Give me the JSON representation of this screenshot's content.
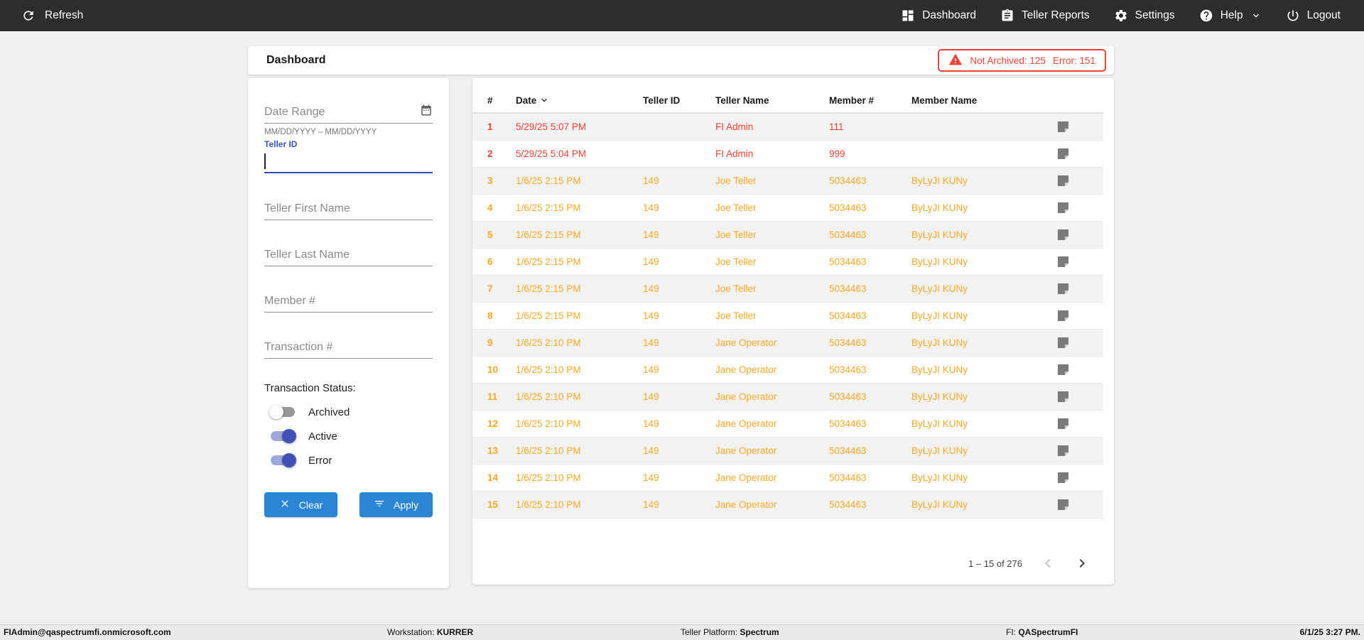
{
  "colors": {
    "error": "#f44336",
    "active_row": "#ffa726",
    "button_blue": "#2a86d5",
    "toggle_indigo": "#3f51b5",
    "topbar_bg": "#2d2d2d"
  },
  "topbar": {
    "refresh_label": "Refresh",
    "refresh_icon": "refresh-icon",
    "nav": [
      {
        "label": "Dashboard",
        "icon": "dashboard-icon",
        "has_dropdown": false
      },
      {
        "label": "Teller Reports",
        "icon": "reports-icon",
        "has_dropdown": false
      },
      {
        "label": "Settings",
        "icon": "settings-icon",
        "has_dropdown": false
      },
      {
        "label": "Help",
        "icon": "help-icon",
        "has_dropdown": true
      },
      {
        "label": "Logout",
        "icon": "logout-icon",
        "has_dropdown": false
      }
    ]
  },
  "header": {
    "title": "Dashboard",
    "alert": {
      "icon": "warning-icon",
      "not_archived": "Not Archived: 125",
      "error": "Error: 151"
    }
  },
  "filters": {
    "date_range": {
      "placeholder": "Date Range",
      "helper": "MM/DD/YYYY – MM/DD/YYYY",
      "icon": "calendar-icon",
      "value": ""
    },
    "teller_id": {
      "label": "Teller ID",
      "value": ""
    },
    "teller_first_name": {
      "placeholder": "Teller First Name",
      "value": ""
    },
    "teller_last_name": {
      "placeholder": "Teller Last Name",
      "value": ""
    },
    "member_number": {
      "placeholder": "Member #",
      "value": ""
    },
    "transaction_number": {
      "placeholder": "Transaction #",
      "value": ""
    },
    "status": {
      "label": "Transaction Status:",
      "toggles": [
        {
          "label": "Archived",
          "on": false
        },
        {
          "label": "Active",
          "on": true
        },
        {
          "label": "Error",
          "on": true
        }
      ]
    },
    "clear_label": "Clear",
    "clear_icon": "close-icon",
    "apply_label": "Apply",
    "apply_icon": "filter-icon"
  },
  "table": {
    "columns": [
      "#",
      "Date",
      "Teller ID",
      "Teller Name",
      "Member #",
      "Member Name"
    ],
    "sorted_column": "Date",
    "sort_direction": "desc",
    "row_icon": "note-icon",
    "rows": [
      {
        "num": "1",
        "date": "5/29/25 5:07 PM",
        "teller_id": "",
        "teller_name": "FI Admin",
        "member_num": "111",
        "member_name": "",
        "status": "error"
      },
      {
        "num": "2",
        "date": "5/29/25 5:04 PM",
        "teller_id": "",
        "teller_name": "FI Admin",
        "member_num": "999",
        "member_name": "",
        "status": "error"
      },
      {
        "num": "3",
        "date": "1/6/25 2:15 PM",
        "teller_id": "149",
        "teller_name": "Joe Teller",
        "member_num": "5034463",
        "member_name": "ByLyJI KUNy",
        "status": "active"
      },
      {
        "num": "4",
        "date": "1/6/25 2:15 PM",
        "teller_id": "149",
        "teller_name": "Joe Teller",
        "member_num": "5034463",
        "member_name": "ByLyJI KUNy",
        "status": "active"
      },
      {
        "num": "5",
        "date": "1/6/25 2:15 PM",
        "teller_id": "149",
        "teller_name": "Joe Teller",
        "member_num": "5034463",
        "member_name": "ByLyJI KUNy",
        "status": "active"
      },
      {
        "num": "6",
        "date": "1/6/25 2:15 PM",
        "teller_id": "149",
        "teller_name": "Joe Teller",
        "member_num": "5034463",
        "member_name": "ByLyJI KUNy",
        "status": "active"
      },
      {
        "num": "7",
        "date": "1/6/25 2:15 PM",
        "teller_id": "149",
        "teller_name": "Joe Teller",
        "member_num": "5034463",
        "member_name": "ByLyJI KUNy",
        "status": "active"
      },
      {
        "num": "8",
        "date": "1/6/25 2:15 PM",
        "teller_id": "149",
        "teller_name": "Joe Teller",
        "member_num": "5034463",
        "member_name": "ByLyJI KUNy",
        "status": "active"
      },
      {
        "num": "9",
        "date": "1/6/25 2:10 PM",
        "teller_id": "149",
        "teller_name": "Jane Operator",
        "member_num": "5034463",
        "member_name": "ByLyJI KUNy",
        "status": "active"
      },
      {
        "num": "10",
        "date": "1/6/25 2:10 PM",
        "teller_id": "149",
        "teller_name": "Jane Operator",
        "member_num": "5034463",
        "member_name": "ByLyJI KUNy",
        "status": "active"
      },
      {
        "num": "11",
        "date": "1/6/25 2:10 PM",
        "teller_id": "149",
        "teller_name": "Jane Operator",
        "member_num": "5034463",
        "member_name": "ByLyJI KUNy",
        "status": "active"
      },
      {
        "num": "12",
        "date": "1/6/25 2:10 PM",
        "teller_id": "149",
        "teller_name": "Jane Operator",
        "member_num": "5034463",
        "member_name": "ByLyJI KUNy",
        "status": "active"
      },
      {
        "num": "13",
        "date": "1/6/25 2:10 PM",
        "teller_id": "149",
        "teller_name": "Jane Operator",
        "member_num": "5034463",
        "member_name": "ByLyJI KUNy",
        "status": "active"
      },
      {
        "num": "14",
        "date": "1/6/25 2:10 PM",
        "teller_id": "149",
        "teller_name": "Jane Operator",
        "member_num": "5034463",
        "member_name": "ByLyJI KUNy",
        "status": "active"
      },
      {
        "num": "15",
        "date": "1/6/25 2:10 PM",
        "teller_id": "149",
        "teller_name": "Jane Operator",
        "member_num": "5034463",
        "member_name": "ByLyJI KUNy",
        "status": "active"
      }
    ],
    "pagination": {
      "range": "1 – 15 of 276",
      "prev_enabled": false,
      "next_enabled": true
    }
  },
  "footer": {
    "user": "FIAdmin@qaspectrumfi.onmicrosoft.com",
    "workstation_label": "Workstation:",
    "workstation": "KURRER",
    "platform_label": "Teller Platform:",
    "platform": "Spectrum",
    "fi_label": "FI:",
    "fi": "QASpectrumFI",
    "datetime": "6/1/25 3:27 PM."
  }
}
